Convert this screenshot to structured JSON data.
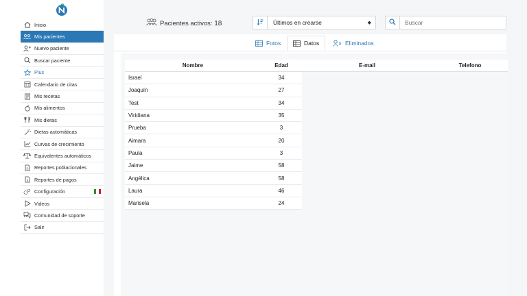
{
  "sidebar": {
    "items": [
      {
        "label": "Inicio",
        "icon": "home-icon"
      },
      {
        "label": "Mis pacientes",
        "icon": "users-icon"
      },
      {
        "label": "Nuevo paciente",
        "icon": "user-plus-icon"
      },
      {
        "label": "Buscar paciente",
        "icon": "search-icon"
      },
      {
        "label": "Plus",
        "icon": "star-icon"
      },
      {
        "label": "Calendario de citas",
        "icon": "calendar-icon"
      },
      {
        "label": "Mis recetas",
        "icon": "recipe-icon"
      },
      {
        "label": "Mis alimentos",
        "icon": "apple-icon"
      },
      {
        "label": "Mis dietas",
        "icon": "cutlery-icon"
      },
      {
        "label": "Dietas automáticas",
        "icon": "magic-wand-icon"
      },
      {
        "label": "Curvas de crecimiento",
        "icon": "line-chart-icon"
      },
      {
        "label": "Equivalentes automáticos",
        "icon": "scale-icon"
      },
      {
        "label": "Reportes poblacionales",
        "icon": "document-icon"
      },
      {
        "label": "Reportes de pagos",
        "icon": "invoice-icon"
      },
      {
        "label": "Configuración",
        "icon": "gears-icon"
      },
      {
        "label": "Videos",
        "icon": "play-icon"
      },
      {
        "label": "Comunidad de soporte",
        "icon": "chat-icon"
      },
      {
        "label": "Salir",
        "icon": "logout-icon"
      }
    ],
    "active_index": 1
  },
  "header": {
    "patients_label": "Pacientes activos:",
    "patients_count": "18",
    "sort_value": "Últimos en crearse",
    "search_placeholder": "Buscar"
  },
  "tabs": [
    {
      "label": "Fotos",
      "icon": "table-grid-icon"
    },
    {
      "label": "Datos",
      "icon": "table-grid-icon"
    },
    {
      "label": "Eliminados",
      "icon": "user-remove-icon"
    }
  ],
  "active_tab": 1,
  "table": {
    "columns": [
      "Nombre",
      "Edad",
      "E-mail",
      "Telefono"
    ],
    "rows": [
      {
        "name": "Israel",
        "age": "34"
      },
      {
        "name": "Joaquín",
        "age": "27"
      },
      {
        "name": "Test",
        "age": "34"
      },
      {
        "name": "Viridiana",
        "age": "35"
      },
      {
        "name": "Prueba",
        "age": "3"
      },
      {
        "name": "Aimara",
        "age": "20"
      },
      {
        "name": "Paula",
        "age": "3"
      },
      {
        "name": "Jaime",
        "age": "58"
      },
      {
        "name": "Angélica",
        "age": "58"
      },
      {
        "name": "Laura",
        "age": "46"
      },
      {
        "name": "Marisela",
        "age": "24"
      }
    ]
  },
  "colors": {
    "accent": "#2b78b6",
    "flag_green": "#2e8b3a",
    "flag_red": "#c8202f"
  }
}
